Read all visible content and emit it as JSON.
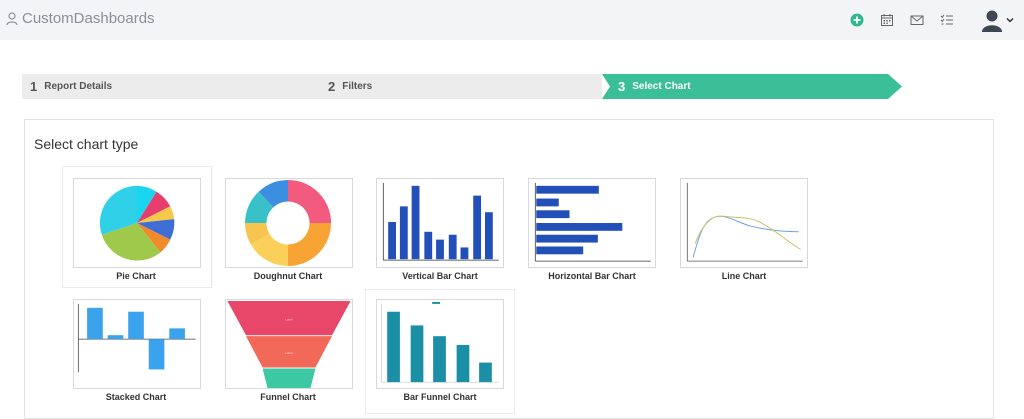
{
  "app": {
    "title": "CustomDashboards"
  },
  "header_icons": [
    "add-circle-icon",
    "calendar-icon",
    "mail-icon",
    "checklist-icon",
    "user-avatar-icon"
  ],
  "wizard": {
    "steps": [
      {
        "number": "1",
        "label": "Report Details",
        "state": "done"
      },
      {
        "number": "2",
        "label": "Filters",
        "state": "done"
      },
      {
        "number": "3",
        "label": "Select Chart",
        "state": "active"
      }
    ],
    "active_color": "#3bbf98"
  },
  "panel": {
    "title": "Select chart type"
  },
  "charts": [
    {
      "label": "Pie Chart"
    },
    {
      "label": "Doughnut Chart"
    },
    {
      "label": "Vertical Bar Chart"
    },
    {
      "label": "Horizontal Bar Chart"
    },
    {
      "label": "Line Chart"
    },
    {
      "label": "Stacked Chart"
    },
    {
      "label": "Funnel Chart"
    },
    {
      "label": "Bar Funnel Chart"
    }
  ]
}
